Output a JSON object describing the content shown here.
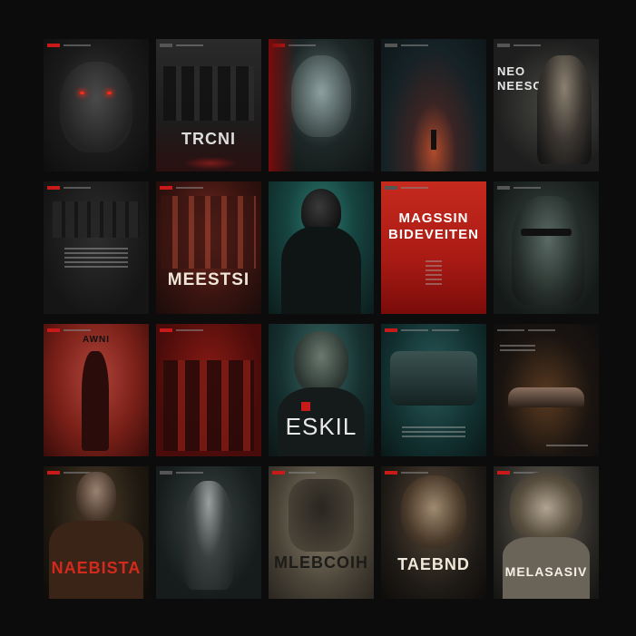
{
  "colors": {
    "background": "#0c0c0c",
    "accent_red": "#c91a1a",
    "dark_teal": "#123030"
  },
  "posters": [
    {
      "title": ""
    },
    {
      "title": "TRCNI"
    },
    {
      "title": ""
    },
    {
      "title": ""
    },
    {
      "title": "NEO NEESO"
    },
    {
      "title": ""
    },
    {
      "title": "MEESTSI"
    },
    {
      "title": ""
    },
    {
      "title": "MAGSSIN BIDEVEITEN"
    },
    {
      "title": ""
    },
    {
      "title": "AWNI"
    },
    {
      "title": ""
    },
    {
      "title": "ESKIL"
    },
    {
      "title": ""
    },
    {
      "title": ""
    },
    {
      "title": "NAEBISTA"
    },
    {
      "title": ""
    },
    {
      "title": "MLEBCOIH"
    },
    {
      "title": "TAEBND"
    },
    {
      "title": "MELASASIV"
    }
  ]
}
